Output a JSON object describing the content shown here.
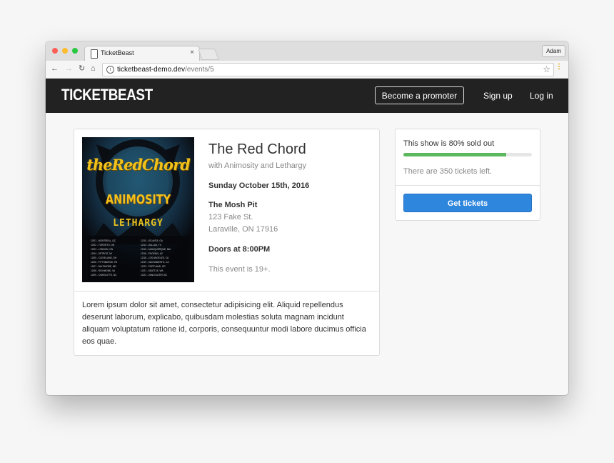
{
  "browser": {
    "tab_title": "TicketBeast",
    "tab_close": "×",
    "profile_name": "Adam",
    "url_host": "ticketbeast-demo.dev",
    "url_path": "/events/5",
    "icons": [
      "back-icon",
      "forward-icon",
      "reload-icon",
      "home-icon",
      "info-icon",
      "star-icon",
      "menu-icon"
    ]
  },
  "nav": {
    "brand": "TICKETBEAST",
    "promoter_button": "Become a promoter",
    "signup": "Sign up",
    "login": "Log in"
  },
  "event": {
    "title": "The Red Chord",
    "subtitle": "with Animosity and Lethargy",
    "date": "Sunday October 15th, 2016",
    "venue": "The Mosh Pit",
    "address_line1": "123 Fake St.",
    "address_line2": "Laraville, ON 17916",
    "doors": "Doors at 8:00PM",
    "age_note": "This event is 19+.",
    "description": "Lorem ipsum dolor sit amet, consectetur adipisicing elit. Aliquid repellendus deserunt laborum, explicabo, quibusdam molestias soluta magnam incidunt aliquam voluptatum ratione id, corporis, consequuntur modi labore ducimus officia eos quae.",
    "poster": {
      "band": "theRedChord",
      "support1": "ANIMOSITY",
      "support2": "LETHARGY"
    }
  },
  "tickets": {
    "sold_text": "This show is 80% sold out",
    "sold_fraction": 0.8,
    "remaining_text": "There are 350 tickets left.",
    "button": "Get tickets"
  },
  "colors": {
    "navbar": "#222223",
    "progress": "#5cb85c",
    "primary": "#2f86dd",
    "poster_accent": "#f2c21b"
  }
}
